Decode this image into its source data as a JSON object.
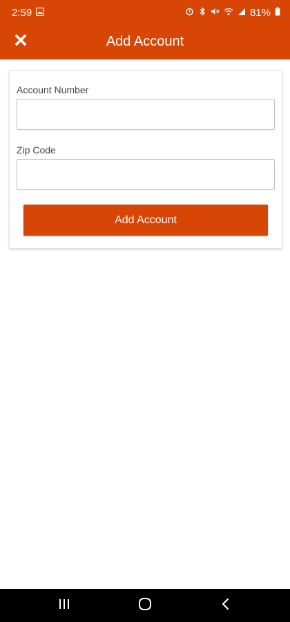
{
  "status_bar": {
    "time": "2:59",
    "battery": "81%",
    "icons": [
      "image-icon",
      "alarm-icon",
      "bluetooth-icon",
      "mute-icon",
      "wifi-icon",
      "signal-icon",
      "battery-icon"
    ]
  },
  "app_bar": {
    "title": "Add Account",
    "close_icon": "close-icon"
  },
  "form": {
    "account_number": {
      "label": "Account Number",
      "value": "",
      "placeholder": ""
    },
    "zip_code": {
      "label": "Zip Code",
      "value": "",
      "placeholder": ""
    },
    "submit_label": "Add Account"
  },
  "nav_bar": {
    "icons": [
      "recent-apps-icon",
      "home-icon",
      "back-icon"
    ]
  },
  "colors": {
    "accent": "#d84606",
    "background": "#ffffff",
    "nav_background": "#000000"
  }
}
